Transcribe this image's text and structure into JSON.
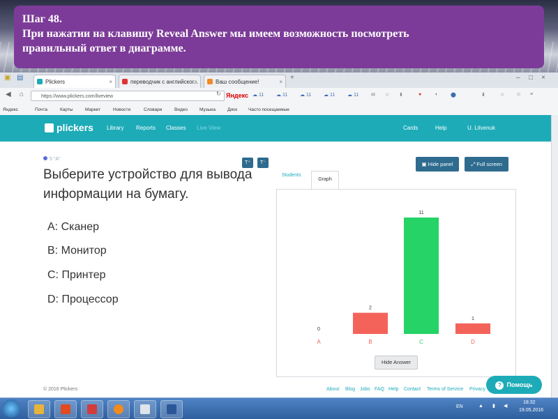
{
  "slide": {
    "title": "Шаг 48.",
    "line1": "При нажатии на клавишу Reveal Answer мы имеем возможность посмотреть",
    "line2": "правильный ответ в диаграмме."
  },
  "browser": {
    "tabs": [
      "Plickers",
      "переводчик с английског...",
      "Ваш сообщение!"
    ],
    "url": "https://www.plickers.com/liveview",
    "search_engine": "Яндекс",
    "weather": [
      "11",
      "11",
      "11",
      "11",
      "11"
    ],
    "bookmarks": [
      "Яндекс",
      "Почта",
      "Карты",
      "Маркет",
      "Новости",
      "Словари",
      "Видео",
      "Музыка",
      "Диск",
      "Часто посещаемые"
    ]
  },
  "app": {
    "logo": "plickers",
    "nav": [
      "Library",
      "Reports",
      "Classes",
      "Live View"
    ],
    "nav_right": [
      "Cards",
      "Help",
      "U. Litvenuk"
    ]
  },
  "question": {
    "tag": "5 \"A\"",
    "text": "Выберите устройство для вывода информации на бумагу.",
    "options": [
      "A: Сканер",
      "B: Монитор",
      "C: Принтер",
      "D: Процессор"
    ],
    "font_buttons": [
      "T⁺",
      "T⁻"
    ]
  },
  "panel": {
    "hide_panel": "Hide panel",
    "full_screen": "Full screen",
    "tabs": [
      "Students",
      "Graph"
    ],
    "hide_answer": "Hide Answer"
  },
  "chart_data": {
    "type": "bar",
    "categories": [
      "A",
      "B",
      "C",
      "D"
    ],
    "values": [
      0,
      2,
      11,
      1
    ],
    "colors": [
      "#f4635a",
      "#f4635a",
      "#25d366",
      "#f4635a"
    ],
    "correct": "C"
  },
  "footer": {
    "copyright": "© 2016 Plickers",
    "links": [
      "About",
      "Blog",
      "Jobs",
      "FAQ",
      "Help",
      "Contact",
      "Terms of Service",
      "Privacy"
    ],
    "help_button": "Помощь"
  },
  "taskbar": {
    "lang": "EN",
    "time": "18:32",
    "date": "19.05.2016"
  }
}
